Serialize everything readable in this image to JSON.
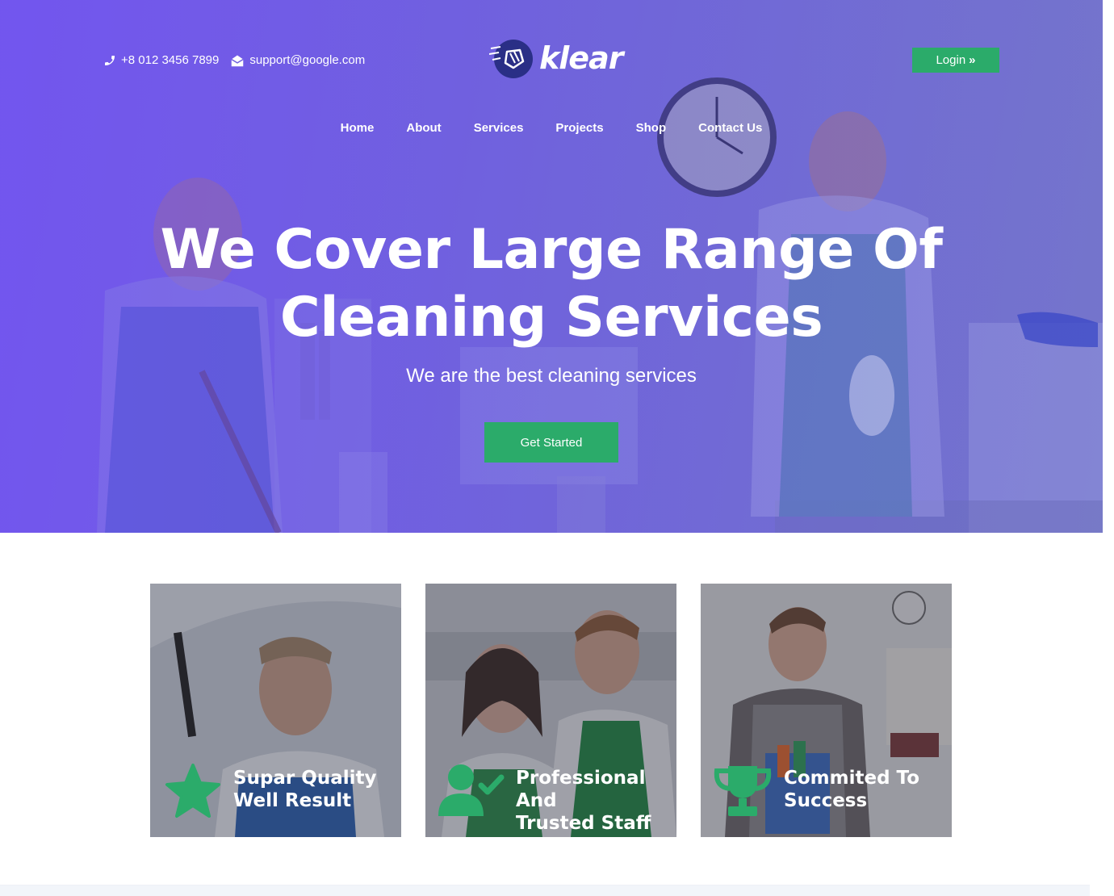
{
  "topbar": {
    "phone": "+8 012 3456 7899",
    "email": "support@google.com",
    "phone_icon": "phone-icon",
    "email_icon": "envelope-open-icon"
  },
  "brand": {
    "name": "klear",
    "logo_icon": "cleaning-hand-icon"
  },
  "login": {
    "label": "Login",
    "icon": "double-chevron-right-icon"
  },
  "nav": {
    "items": [
      "Home",
      "About",
      "Services",
      "Projects",
      "Shop",
      "Contact Us"
    ]
  },
  "hero": {
    "title_line1": "We Cover Large Range Of",
    "title_line2": "Cleaning Services",
    "subtitle": "We are the best cleaning services",
    "cta": "Get Started"
  },
  "features": [
    {
      "line1": "Supar Quality",
      "line2": "Well Result",
      "icon": "star-icon"
    },
    {
      "line1": "Professional And",
      "line2": "Trusted Staff",
      "icon": "user-check-icon"
    },
    {
      "line1": "Commited To",
      "line2": "Success",
      "icon": "trophy-icon"
    }
  ],
  "colors": {
    "accent_green": "#2bab6a",
    "hero_purple": "#7353f2",
    "logo_navy": "#2a2f86"
  }
}
